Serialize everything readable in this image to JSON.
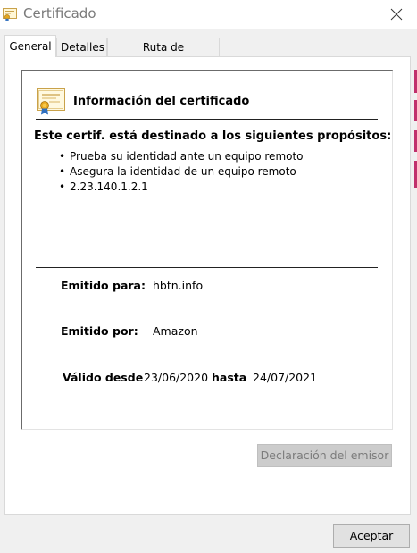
{
  "window": {
    "title": "Certificado"
  },
  "tabs": [
    {
      "label": "General",
      "active": true
    },
    {
      "label": "Detalles",
      "active": false
    },
    {
      "label": "Ruta de certificación",
      "active": false
    }
  ],
  "general": {
    "heading": "Información del certificado",
    "purpose_heading": "Este certif. está destinado a los siguientes propósitos:",
    "purposes": [
      "Prueba su identidad ante un equipo remoto",
      "Asegura la identidad de un equipo remoto",
      "2.23.140.1.2.1"
    ],
    "issued_to_label": "Emitido para:",
    "issued_to_value": "hbtn.info",
    "issued_by_label": "Emitido por:",
    "issued_by_value": "Amazon",
    "valid_from_label": "Válido desde",
    "valid_from_value": "23/06/2020",
    "valid_to_label": "hasta",
    "valid_to_value": "24/07/2021"
  },
  "buttons": {
    "issuer_statement": "Declaración del emisor",
    "accept": "Aceptar"
  },
  "icons": {
    "title": "certificate-icon",
    "close": "close-icon",
    "header": "certificate-icon"
  },
  "colors": {
    "title_text": "#7a7a7a",
    "disabled_button": "#cccccc",
    "accent_edge": "#c0306c"
  }
}
